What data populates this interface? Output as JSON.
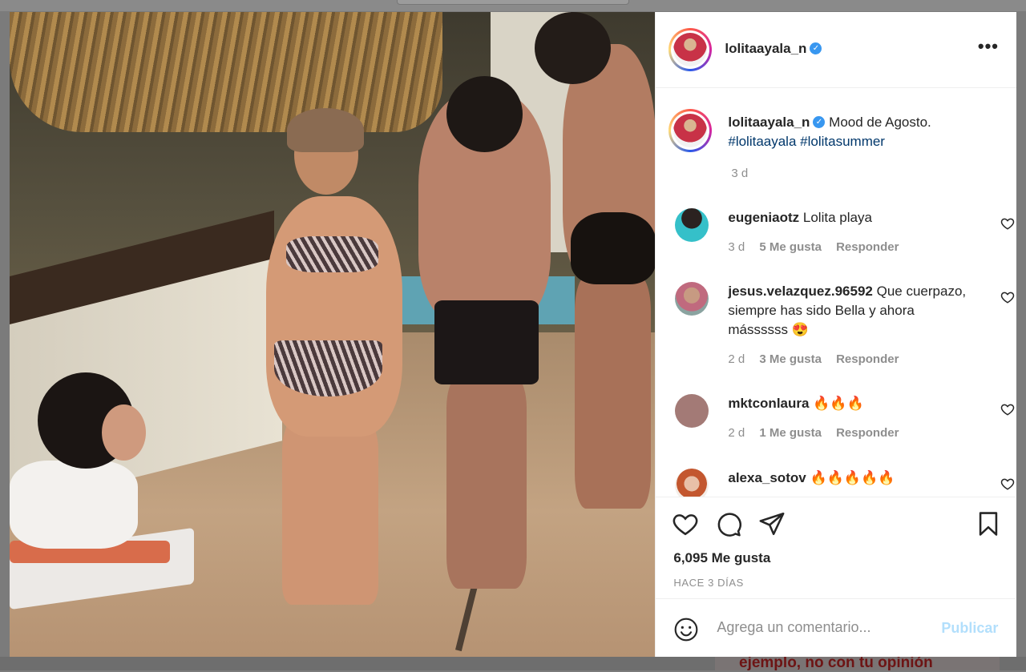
{
  "colors": {
    "accent": "#0095f6",
    "link_tag": "#00376b",
    "publish_disabled": "#b2dffc",
    "verified": "#3897f0",
    "text": "#262626",
    "muted": "#8e8e8e"
  },
  "background": {
    "footer_text": "ejemplo, no con tu opinión"
  },
  "post": {
    "author": "lolitaayala_n",
    "caption": "Mood de Agosto.",
    "hashtags": [
      "#lolitaayala",
      "#lolitasummer"
    ],
    "caption_time": "3 d",
    "likes": "6,095 Me gusta",
    "posted": "HACE 3 DÍAS"
  },
  "comments": [
    {
      "user": "eugeniaotz",
      "text": "Lolita playa",
      "time": "3 d",
      "likes": "5 Me gusta",
      "reply": "Responder"
    },
    {
      "user": "jesus.velazquez.96592",
      "text": "Que cuerpazo, siempre has sido Bella y ahora mássssss 😍",
      "time": "2 d",
      "likes": "3 Me gusta",
      "reply": "Responder"
    },
    {
      "user": "mktconlaura",
      "text": "🔥🔥🔥",
      "time": "2 d",
      "likes": "1 Me gusta",
      "reply": "Responder"
    },
    {
      "user": "alexa_sotov",
      "text": "🔥🔥🔥🔥🔥"
    }
  ],
  "composer": {
    "placeholder": "Agrega un comentario...",
    "publish": "Publicar"
  },
  "icons": {
    "more": "more-options-icon",
    "like": "heart-icon",
    "comment": "comment-icon",
    "share": "send-icon",
    "save": "bookmark-icon",
    "emoji": "emoji-icon"
  }
}
